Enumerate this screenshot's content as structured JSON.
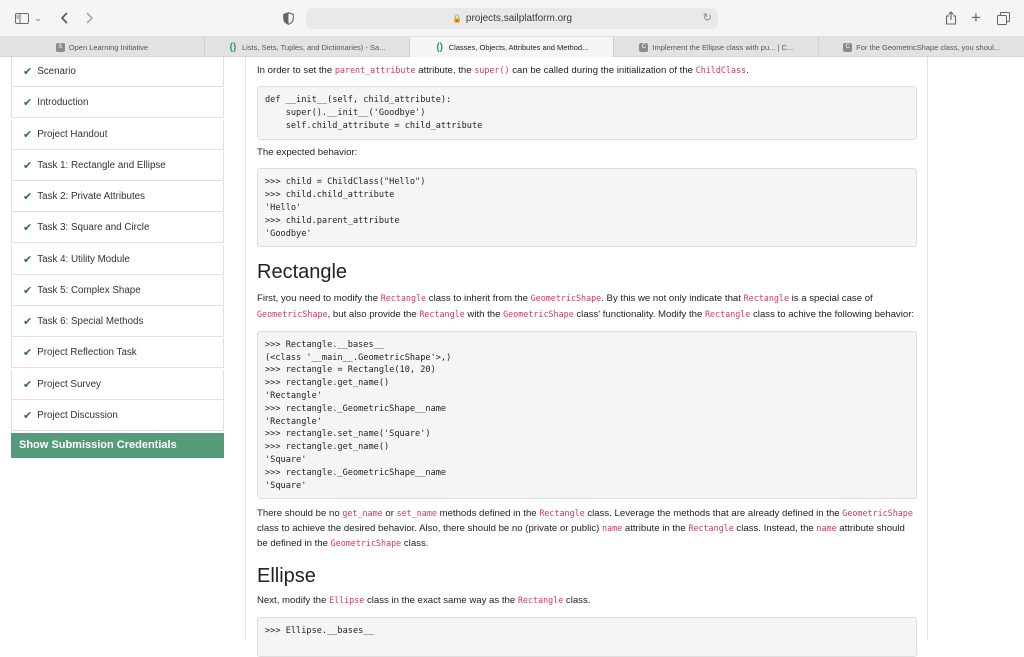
{
  "browser": {
    "url": "projects.sailplatform.org",
    "tabs": [
      {
        "label": "Open Learning Initiative",
        "icon": "S"
      },
      {
        "label": "Lists, Sets, Tuples, and Dictionaries) - Sa...",
        "icon": "()"
      },
      {
        "label": "Classes, Objects, Attributes and Method...",
        "icon": "()"
      },
      {
        "label": "Implement the Ellipse class with pu... | C...",
        "icon": "C"
      },
      {
        "label": "For the GeometricShape class, you shoul...",
        "icon": "C"
      }
    ],
    "active_tab_index": 2
  },
  "sidebar": {
    "items": [
      {
        "label": "Scenario"
      },
      {
        "label": "Introduction"
      },
      {
        "label": "Project Handout"
      },
      {
        "label": "Task 1: Rectangle and Ellipse"
      },
      {
        "label": "Task 2: Private Attributes"
      },
      {
        "label": "Task 3: Square and Circle"
      },
      {
        "label": "Task 4: Utility Module"
      },
      {
        "label": "Task 5: Complex Shape"
      },
      {
        "label": "Task 6: Special Methods"
      },
      {
        "label": "Project Reflection Task"
      },
      {
        "label": "Project Survey"
      },
      {
        "label": "Project Discussion"
      }
    ],
    "submit_label": "Show Submission Credentials"
  },
  "content": {
    "intro": {
      "t1": "In order to set the ",
      "c1": "parent_attribute",
      "t2": " attribute, the ",
      "c2": "super()",
      "t3": " can be called during the initialization of the ",
      "c3": "ChildClass",
      "t4": "."
    },
    "code1": "def __init__(self, child_attribute):\n    super().__init__('Goodbye')\n    self.child_attribute = child_attribute",
    "expected": "The expected behavior:",
    "code2": ">>> child = ChildClass(\"Hello\")\n>>> child.child_attribute\n'Hello'\n>>> child.parent_attribute\n'Goodbye'",
    "rect_heading": "Rectangle",
    "rect_p": {
      "t1": "First, you need to modify the ",
      "c1": "Rectangle",
      "t2": " class to inherit from the ",
      "c2": "GeometricShape",
      "t3": ". By this we not only indicate that ",
      "c3": "Rectangle",
      "t4": " is a special case of ",
      "c4": "GeometricShape",
      "t5": ", but also provide the ",
      "c5": "Rectangle",
      "t6": " with the ",
      "c6": "GeometricShape",
      "t7": " class' functionality. Modify the ",
      "c7": "Rectangle",
      "t8": " class to achive the following behavior:"
    },
    "code3": ">>> Rectangle.__bases__\n(<class '__main__.GeometricShape'>,)\n>>> rectangle = Rectangle(10, 20)\n>>> rectangle.get_name()\n'Rectangle'\n>>> rectangle._GeometricShape__name\n'Rectangle'\n>>> rectangle.set_name('Square')\n>>> rectangle.get_name()\n'Square'\n>>> rectangle._GeometricShape__name\n'Square'",
    "rect_p2": {
      "t1": "There should be no ",
      "c1": "get_name",
      "t2": " or ",
      "c2": "set_name",
      "t3": " methods defined in the ",
      "c3": "Rectangle",
      "t4": " class. Leverage the methods that are already defined in the ",
      "c4": "GeometricShape",
      "t5": " class to achieve the desired behavior. Also, there should be no (private or public) ",
      "c5": "name",
      "t6": " attribute in the ",
      "c6": "Rectangle",
      "t7": " class. Instead, the ",
      "c7": "name",
      "t8": " attribute should be defined in the ",
      "c8": "GeometricShape",
      "t9": " class."
    },
    "ellipse_heading": "Ellipse",
    "ellipse_p": {
      "t1": "Next, modify the ",
      "c1": "Ellipse",
      "t2": " class in the exact same way as the ",
      "c2": "Rectangle",
      "t3": " class."
    },
    "code4": ">>> Ellipse.__bases__"
  }
}
